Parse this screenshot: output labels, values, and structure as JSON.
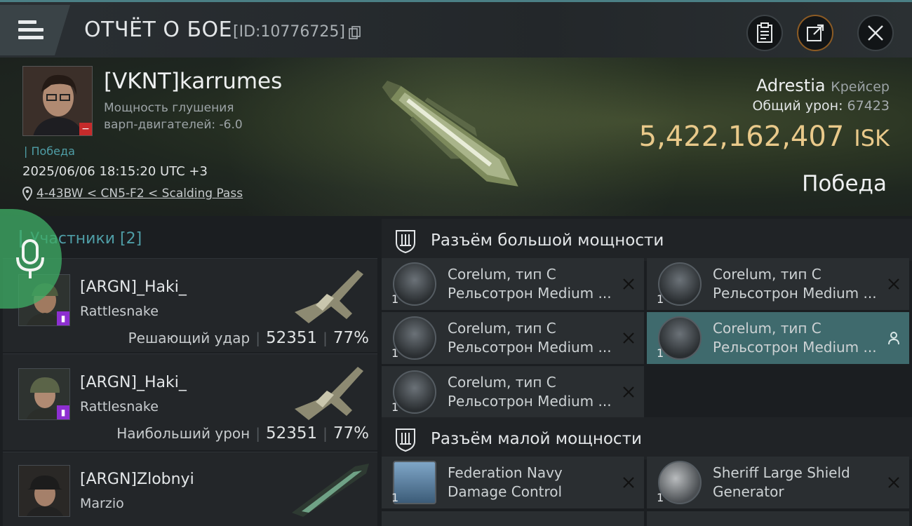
{
  "header": {
    "title": "ОТЧЁТ О БОЕ",
    "battle_id": "[ID:10776725]",
    "icons": [
      "menu-icon",
      "copy-icon",
      "clipboard-icon",
      "share-icon",
      "close-icon"
    ],
    "accent_color": "#4b7f85"
  },
  "hero": {
    "pilot_name": "[VKNT]karrumes",
    "stat_line1": "Мощность глушения",
    "stat_line2": "варп-двигателей: -6.0",
    "victory_small": "Победа",
    "datetime": "2025/06/06 18:15:20 UTC +3",
    "location": "4-43BW < CN5-F2 < Scalding Pass",
    "ship_name": "Adrestia",
    "ship_class": "Крейсер",
    "damage_label": "Общий урон:",
    "damage_value": "67423",
    "isk_value": "5,422,162,407",
    "isk_unit": "ISK",
    "victory_big": "Победа",
    "isk_color": "#e9c98a"
  },
  "participants": {
    "title": "Участники [2]",
    "rows": [
      {
        "name": "[ARGN]_Haki_",
        "ship": "Rattlesnake",
        "label": "Решающий удар",
        "damage": "52351",
        "pct": "77%"
      },
      {
        "name": "[ARGN]_Haki_",
        "ship": "Rattlesnake",
        "label": "Наибольший урон",
        "damage": "52351",
        "pct": "77%"
      },
      {
        "name": "[ARGN]Zlobnyi",
        "ship": "Marzio"
      }
    ]
  },
  "modules": {
    "high_slot_title": "Разъём большой мощности",
    "low_slot_title": "Разъём малой мощности",
    "high": [
      {
        "line1": "Corelum, тип С",
        "line2": "Рельсотрон Medium ...",
        "qty": "1",
        "action": "close-icon"
      },
      {
        "line1": "Corelum, тип С",
        "line2": "Рельсотрон Medium ...",
        "qty": "1",
        "action": "close-icon"
      },
      {
        "line1": "Corelum, тип С",
        "line2": "Рельсотрон Medium ...",
        "qty": "1",
        "action": "close-icon"
      },
      {
        "line1": "Corelum, тип С",
        "line2": "Рельсотрон Medium ...",
        "qty": "1",
        "action": "person-icon"
      },
      {
        "line1": "Corelum, тип С",
        "line2": "Рельсотрон Medium ...",
        "qty": "1",
        "action": "close-icon"
      }
    ],
    "low": [
      {
        "line1": "Federation Navy",
        "line2": "Damage Control",
        "qty": "1",
        "action": "close-icon"
      },
      {
        "line1": "Sheriff Large Shield",
        "line2": "Generator",
        "qty": "1",
        "action": "close-icon"
      }
    ],
    "active_color": "#3f6a6d"
  }
}
